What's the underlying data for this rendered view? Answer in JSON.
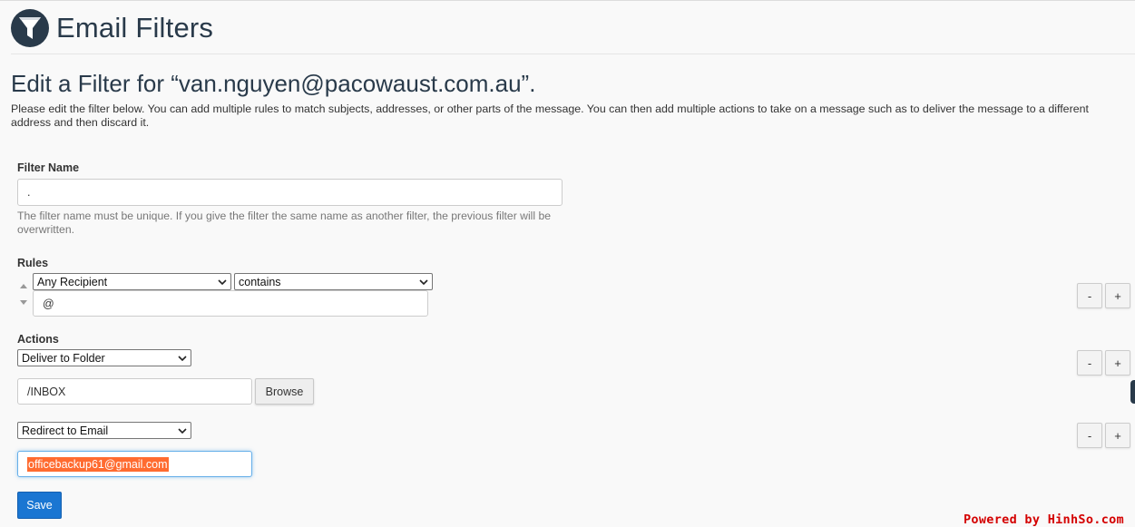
{
  "header": {
    "title": "Email Filters",
    "logo_icon": "funnel-icon"
  },
  "subtitle": "Edit a Filter for “van.nguyen@pacowaust.com.au”.",
  "description": "Please edit the filter below. You can add multiple rules to match subjects, addresses, or other parts of the message. You can then add multiple actions to take on a message such as to deliver the message to a different address and then discard it.",
  "filter_name": {
    "label": "Filter Name",
    "value": ".",
    "help": "The filter name must be unique. If you give the filter the same name as another filter, the previous filter will be overwritten."
  },
  "rules": {
    "label": "Rules",
    "items": [
      {
        "field": "Any Recipient",
        "operator": "contains",
        "value": "@"
      }
    ]
  },
  "actions": {
    "label": "Actions",
    "items": [
      {
        "action": "Deliver to Folder",
        "value": "/INBOX",
        "button": "Browse"
      },
      {
        "action": "Redirect to Email",
        "value": "officebackup61@gmail.com"
      }
    ]
  },
  "buttons": {
    "remove": "-",
    "add": "+",
    "save": "Save"
  },
  "footer": {
    "powered": "Powered by HinhSo.com"
  },
  "colors": {
    "primary": "#1a76d2",
    "heading": "#293a4a",
    "selection": "#ff6b30",
    "watermark": "#d40000"
  }
}
